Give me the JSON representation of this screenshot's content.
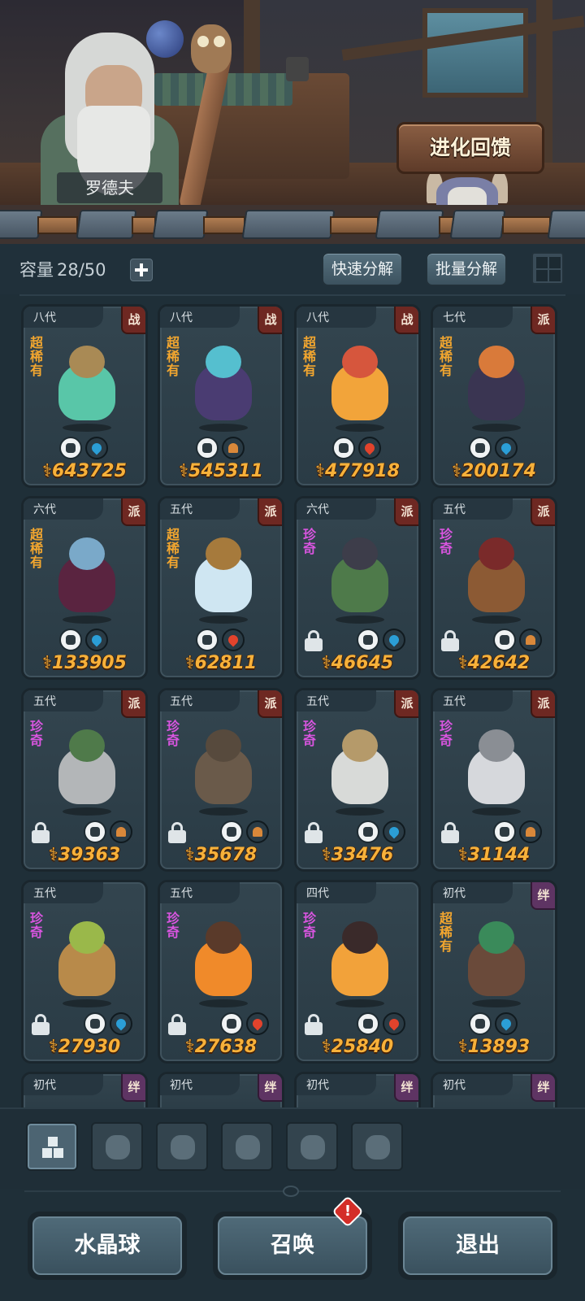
{
  "header": {
    "npc_name": "罗德夫",
    "evolve_button": "进化回馈"
  },
  "toolbar": {
    "capacity_label": "容量",
    "capacity_value": "28/50",
    "quick_decompose": "快速分解",
    "batch_decompose": "批量分解"
  },
  "cards": [
    {
      "gen": "八代",
      "badge": "战",
      "rarity": "超稀有",
      "power": "643725",
      "locked": false,
      "class_icon": "fist-icon",
      "element": "water",
      "colors": [
        "#59c6a8",
        "#a98a55"
      ]
    },
    {
      "gen": "八代",
      "badge": "战",
      "rarity": "超稀有",
      "power": "545311",
      "locked": false,
      "class_icon": "shield-icon",
      "element": "earth",
      "colors": [
        "#4a3c72",
        "#55bfcf"
      ]
    },
    {
      "gen": "八代",
      "badge": "战",
      "rarity": "超稀有",
      "power": "477918",
      "locked": false,
      "class_icon": "leaf-icon",
      "element": "fire",
      "colors": [
        "#f2a43a",
        "#d6563d"
      ]
    },
    {
      "gen": "七代",
      "badge": "派",
      "rarity": "超稀有",
      "power": "200174",
      "locked": false,
      "class_icon": "alien-icon",
      "element": "water",
      "colors": [
        "#3a3552",
        "#d97a3a"
      ]
    },
    {
      "gen": "六代",
      "badge": "派",
      "rarity": "超稀有",
      "power": "133905",
      "locked": false,
      "class_icon": "leaf-icon",
      "element": "water",
      "colors": [
        "#5a2440",
        "#7aa9c9"
      ]
    },
    {
      "gen": "五代",
      "badge": "派",
      "rarity": "超稀有",
      "power": "62811",
      "locked": false,
      "class_icon": "tower-icon",
      "element": "fire",
      "colors": [
        "#cfe6f2",
        "#a67a3c"
      ]
    },
    {
      "gen": "六代",
      "badge": "派",
      "rarity": "珍奇",
      "power": "46645",
      "locked": true,
      "class_icon": "leaf-icon",
      "element": "water",
      "colors": [
        "#4e7a4a",
        "#3d3d4a"
      ]
    },
    {
      "gen": "五代",
      "badge": "派",
      "rarity": "珍奇",
      "power": "42642",
      "locked": true,
      "class_icon": "fist-icon",
      "element": "earth",
      "colors": [
        "#8c5a34",
        "#7a2a2a"
      ]
    },
    {
      "gen": "五代",
      "badge": "派",
      "rarity": "珍奇",
      "power": "39363",
      "locked": true,
      "class_icon": "shield-icon",
      "element": "earth",
      "colors": [
        "#b3b6b8",
        "#4f7a4a"
      ]
    },
    {
      "gen": "五代",
      "badge": "派",
      "rarity": "珍奇",
      "power": "35678",
      "locked": true,
      "class_icon": "shield-icon",
      "element": "earth",
      "colors": [
        "#6a5a4a",
        "#574a3d"
      ]
    },
    {
      "gen": "五代",
      "badge": "派",
      "rarity": "珍奇",
      "power": "33476",
      "locked": true,
      "class_icon": "leaf-icon",
      "element": "water",
      "colors": [
        "#d8dad8",
        "#b59a6a"
      ]
    },
    {
      "gen": "五代",
      "badge": "派",
      "rarity": "珍奇",
      "power": "31144",
      "locked": true,
      "class_icon": "alien-icon",
      "element": "earth",
      "colors": [
        "#d6d8dc",
        "#8a8e94"
      ]
    },
    {
      "gen": "五代",
      "badge": "",
      "rarity": "珍奇",
      "power": "27930",
      "locked": true,
      "class_icon": "alien-icon",
      "element": "water",
      "colors": [
        "#b88a4a",
        "#9ab84a"
      ]
    },
    {
      "gen": "五代",
      "badge": "",
      "rarity": "珍奇",
      "power": "27638",
      "locked": true,
      "class_icon": "fist-icon",
      "element": "fire",
      "colors": [
        "#f08a2a",
        "#5a3a2a"
      ]
    },
    {
      "gen": "四代",
      "badge": "",
      "rarity": "珍奇",
      "power": "25840",
      "locked": true,
      "class_icon": "shield-icon",
      "element": "fire",
      "colors": [
        "#f2a23a",
        "#3a2a2a"
      ]
    },
    {
      "gen": "初代",
      "badge": "绊",
      "rarity": "超稀有",
      "power": "13893",
      "locked": false,
      "class_icon": "alien-icon",
      "element": "water",
      "colors": [
        "#6a4a3a",
        "#3a8a5a"
      ]
    }
  ],
  "peek_cards": [
    {
      "gen": "初代",
      "badge": "绊"
    },
    {
      "gen": "初代",
      "badge": "绊"
    },
    {
      "gen": "初代",
      "badge": "绊"
    },
    {
      "gen": "初代",
      "badge": "绊"
    }
  ],
  "filters": [
    {
      "name": "all-filter",
      "icon": "blocks-icon",
      "active": true
    },
    {
      "name": "fist-filter",
      "icon": "fist-icon",
      "active": false
    },
    {
      "name": "shield-filter",
      "icon": "shield-icon",
      "active": false
    },
    {
      "name": "leaf-filter",
      "icon": "leaf-icon",
      "active": false
    },
    {
      "name": "alien-filter",
      "icon": "alien-icon",
      "active": false
    },
    {
      "name": "tower-filter",
      "icon": "tower-icon",
      "active": false
    }
  ],
  "bottom": {
    "crystal_ball": "水晶球",
    "summon": "召唤",
    "exit": "退出",
    "alert_mark": "!"
  },
  "colors": {
    "power": "#f7b13a",
    "super_rare": "#f2a62f",
    "rare": "#d955e0",
    "badge_red": "#6e2822",
    "badge_purple": "#5e3463"
  }
}
